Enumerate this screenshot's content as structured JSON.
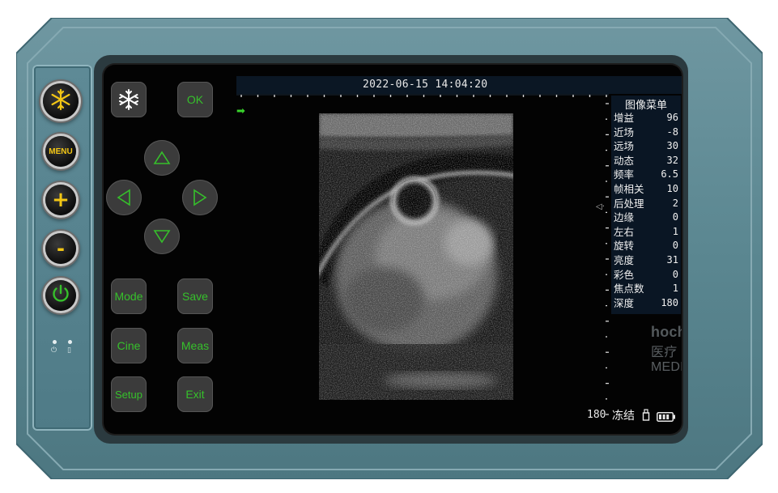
{
  "device": {
    "housing_color": "#5b8791",
    "accent_green": "#36c02b",
    "accent_yellow": "#f3c614"
  },
  "hardware_buttons": [
    {
      "id": "freeze",
      "icon": "snowflake-icon"
    },
    {
      "id": "menu",
      "label": "MENU"
    },
    {
      "id": "plus",
      "label": "+"
    },
    {
      "id": "minus",
      "label": "-"
    },
    {
      "id": "power",
      "icon": "power-icon"
    }
  ],
  "soft_keys": {
    "freeze_icon": "snowflake-icon",
    "ok": "OK",
    "dpad": [
      "up-arrow-icon",
      "left-arrow-icon",
      "right-arrow-icon",
      "down-arrow-icon"
    ],
    "mode": "Mode",
    "save": "Save",
    "cine": "Cine",
    "meas": "Meas",
    "setup": "Setup",
    "exit": "Exit"
  },
  "header": {
    "datetime": "2022-06-15   14:04:20"
  },
  "menu": {
    "title": "图像菜单",
    "items": [
      {
        "label": "增益",
        "value": "96"
      },
      {
        "label": "近场",
        "value": "-8"
      },
      {
        "label": "远场",
        "value": "30"
      },
      {
        "label": "动态",
        "value": "32"
      },
      {
        "label": "频率",
        "value": "6.5"
      },
      {
        "label": "帧相关",
        "value": "10"
      },
      {
        "label": "后处理",
        "value": "2"
      },
      {
        "label": "边缘",
        "value": "0"
      },
      {
        "label": "左右",
        "value": "1"
      },
      {
        "label": "旋转",
        "value": "0"
      },
      {
        "label": "亮度",
        "value": "31"
      },
      {
        "label": "彩色",
        "value": "0"
      },
      {
        "label": "焦点数",
        "value": "1"
      },
      {
        "label": "深度",
        "value": "180"
      }
    ]
  },
  "status": {
    "depth": "180",
    "freeze": "冻结"
  },
  "watermark": {
    "brand": "hochey",
    "text": "医疗 MEDICAL"
  }
}
